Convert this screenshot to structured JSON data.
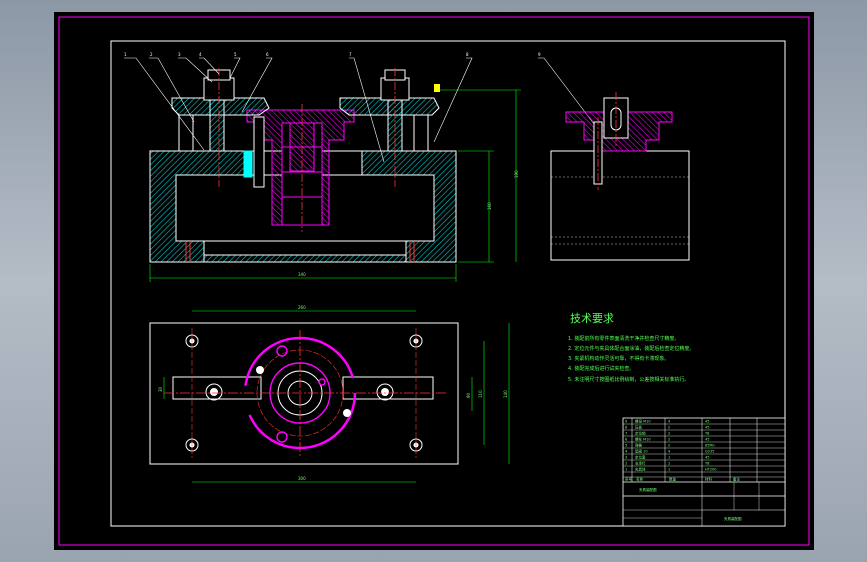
{
  "colors": {
    "background": "#000000",
    "outline": "#ffffff",
    "hatch": "#00ffff",
    "fixture": "#ff00ff",
    "dimension": "#00ff00",
    "frame": "#ff00ff",
    "center_line": "#ff3333",
    "accent": "#ffff00"
  },
  "tech_requirements": {
    "title": "技术要求",
    "items": [
      "1. 装配前所有零件表面清洗干净并检查尺寸精度。",
      "2. 定位元件与夹具体配合面涂油，装配后检查定位精度。",
      "3. 夹紧机构动作灵活可靠，不得有卡滞现象。",
      "4. 装配完成后进行试夹检查。",
      "5. 未注明尺寸按图纸比例绘制，公差按相关标准执行。"
    ]
  },
  "dimensions": {
    "front_width": "340",
    "front_height": "160",
    "front_height_2": "190",
    "plan_top": "260",
    "plan_bottom": "300",
    "plan_left": "30",
    "plan_right_1": "90",
    "plan_right_2": "110",
    "plan_right_3": "140"
  },
  "leaders": [
    "1",
    "2",
    "3",
    "4",
    "5",
    "6",
    "7",
    "8",
    "9"
  ],
  "title_block": {
    "drawing_name": "夹具装配图",
    "rows": [
      {
        "no": "9",
        "name": "螺母 M10",
        "qty": "4",
        "material": "45"
      },
      {
        "no": "8",
        "name": "压板",
        "qty": "2",
        "material": "45"
      },
      {
        "no": "7",
        "name": "定位销",
        "qty": "2",
        "material": "T8"
      },
      {
        "no": "6",
        "name": "螺柱 M10",
        "qty": "2",
        "material": "45"
      },
      {
        "no": "5",
        "name": "弹簧",
        "qty": "2",
        "material": "65Mn"
      },
      {
        "no": "4",
        "name": "垫圈 10",
        "qty": "4",
        "material": "Q235"
      },
      {
        "no": "3",
        "name": "定位套",
        "qty": "1",
        "material": "45"
      },
      {
        "no": "2",
        "name": "支承钉",
        "qty": "2",
        "material": "T8"
      },
      {
        "no": "1",
        "name": "夹具体",
        "qty": "1",
        "material": "HT200"
      }
    ],
    "header": [
      "序号",
      "名称",
      "数量",
      "材料",
      "备注"
    ]
  }
}
